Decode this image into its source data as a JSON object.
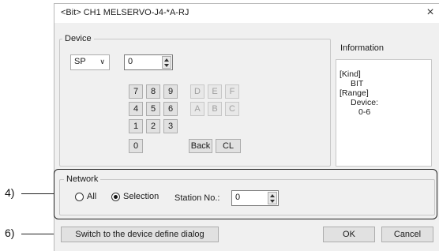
{
  "dialog": {
    "title": "<Bit> CH1 MELSERVO-J4-*A-RJ",
    "close_glyph": "×"
  },
  "device": {
    "group_label": "Device",
    "type_value": "SP",
    "number_value": "0",
    "keys_row1": [
      "7",
      "8",
      "9",
      "D",
      "E",
      "F"
    ],
    "keys_row2": [
      "4",
      "5",
      "6",
      "A",
      "B",
      "C"
    ],
    "keys_row3": [
      "1",
      "2",
      "3"
    ],
    "key_zero": "0",
    "back_label": "Back",
    "clear_label": "CL"
  },
  "information": {
    "label": "Information",
    "lines": [
      "[Kind]",
      "BIT",
      "[Range]",
      "Device:",
      "0-6"
    ]
  },
  "network": {
    "group_label": "Network",
    "option_all": "All",
    "option_selection": "Selection",
    "selected": "Selection",
    "station_label": "Station No.:",
    "station_value": "0"
  },
  "footer": {
    "switch_label": "Switch to the device define dialog",
    "ok_label": "OK",
    "cancel_label": "Cancel"
  },
  "callouts": {
    "network": "4)",
    "switch": "6)"
  }
}
